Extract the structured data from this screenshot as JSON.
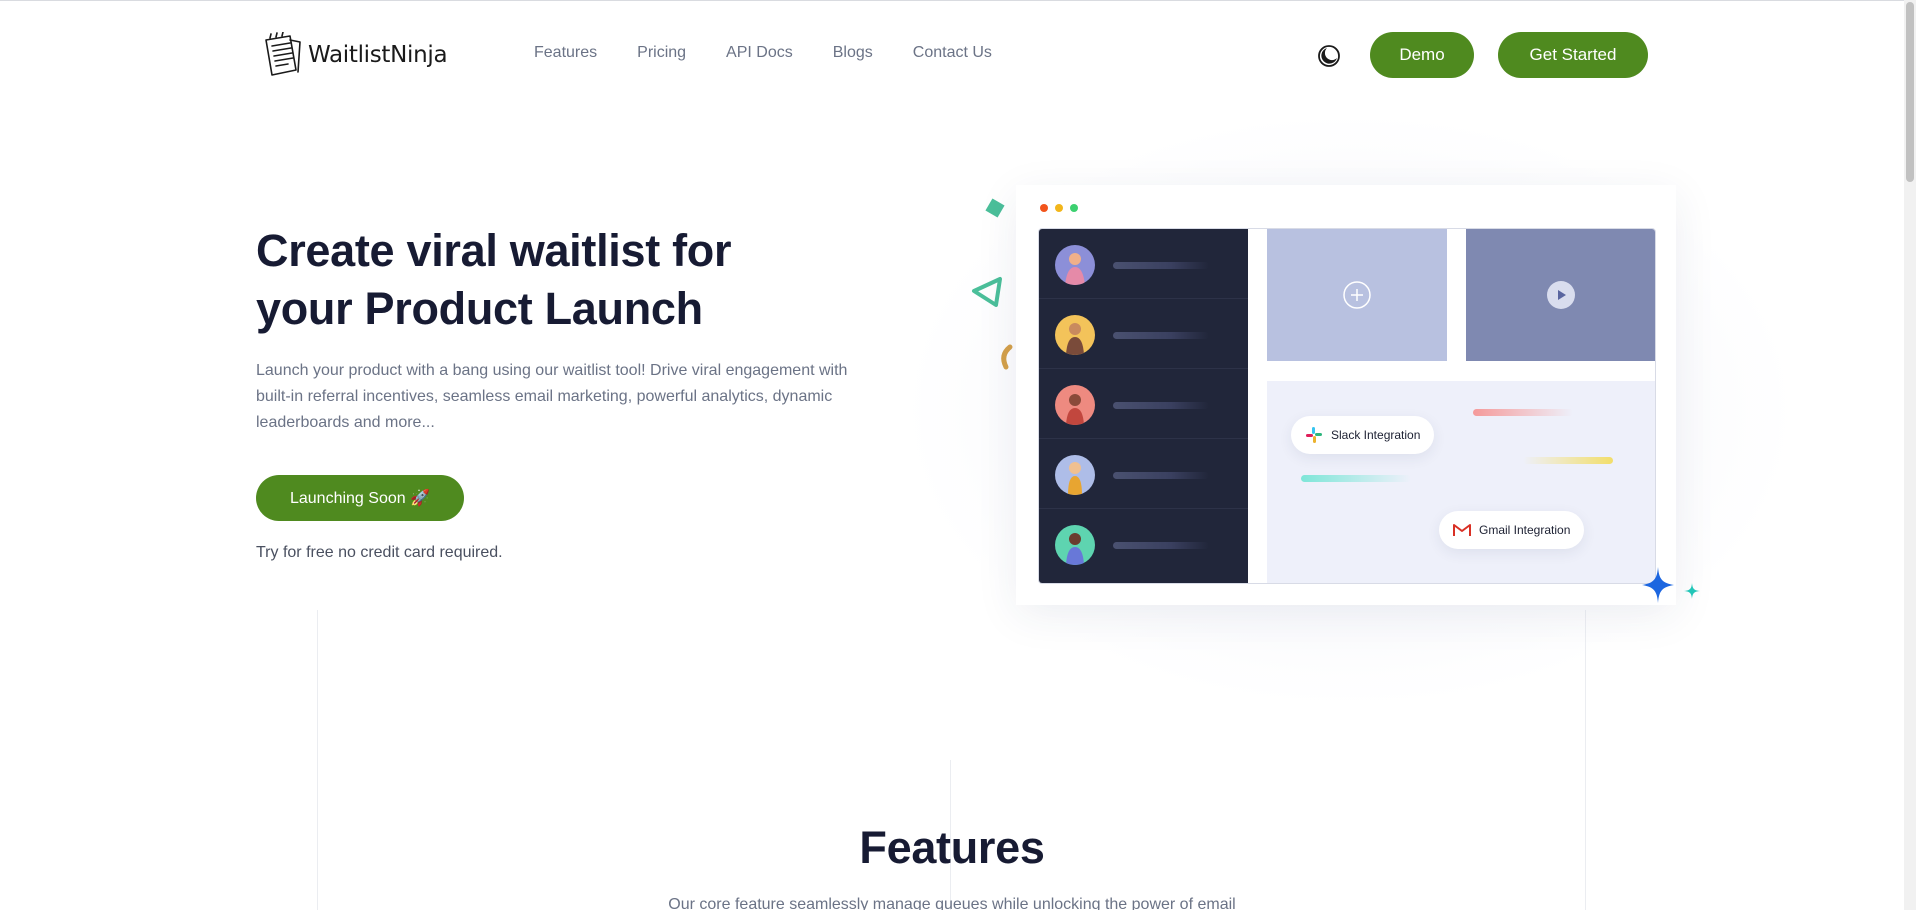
{
  "brand": {
    "name": "WaitlistNinja",
    "accent": "#4f8a1f"
  },
  "nav": {
    "items": [
      {
        "label": "Features"
      },
      {
        "label": "Pricing"
      },
      {
        "label": "API Docs"
      },
      {
        "label": "Blogs"
      },
      {
        "label": "Contact Us"
      }
    ],
    "theme_icon": "moon-icon",
    "demo_label": "Demo",
    "get_started_label": "Get Started"
  },
  "hero": {
    "title_before": "Create ",
    "title_highlight": "viral waitlist",
    "title_after": " for your Product Launch",
    "description": "Launch your product with a bang using our waitlist tool! Drive viral engagement with built-in referral incentives, seamless email marketing, powerful analytics, dynamic leaderboards and more...",
    "cta_label": "Launching Soon 🚀",
    "note": "Try for free no credit card required."
  },
  "illustration": {
    "slack_label": "Slack Integration",
    "gmail_label": "Gmail Integration",
    "window_dot_colors": [
      "#f2541b",
      "#f2b61b",
      "#3cd070"
    ]
  },
  "features": {
    "title": "Features",
    "subtitle": "Our core feature seamlessly manage queues while unlocking the power of email"
  }
}
